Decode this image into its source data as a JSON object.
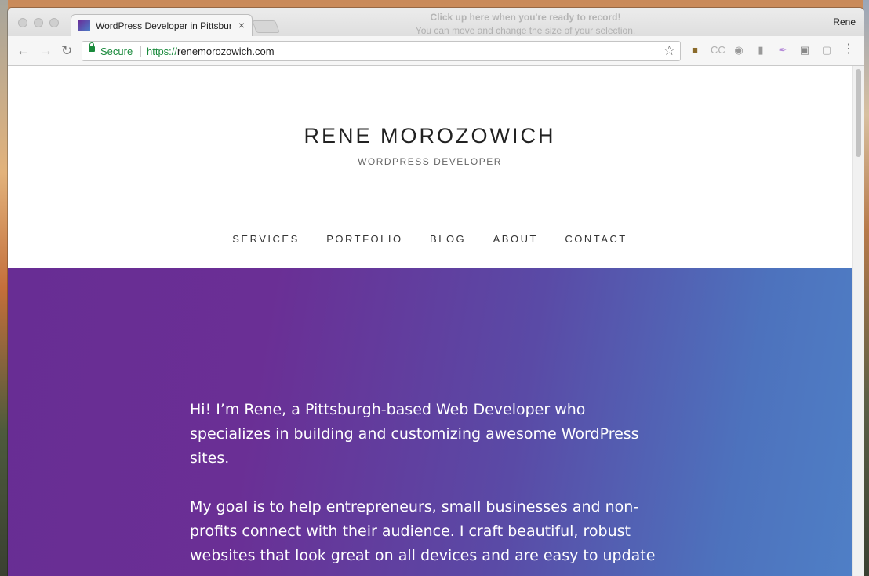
{
  "browser": {
    "tab": {
      "title": "WordPress Developer in Pittsburgh",
      "close": "×"
    },
    "record_hint": {
      "line1": "Click up here when you're ready to record!",
      "line2": "You can move and change the size of your selection."
    },
    "profile_name": "Rene",
    "toolbar": {
      "back": "←",
      "forward": "→",
      "reload": "↻",
      "secure_label": "Secure",
      "url_scheme": "https://",
      "url_host": "renemorozowich.com",
      "star": "☆",
      "menu": "⋮",
      "extensions": [
        "evernote-icon",
        "closed-captions-icon",
        "camera-icon",
        "bookmark-icon",
        "feather-icon",
        "cast-icon",
        "screen-icon"
      ]
    }
  },
  "site": {
    "title": "RENE MOROZOWICH",
    "tagline": "WORDPRESS DEVELOPER",
    "nav": [
      "SERVICES",
      "PORTFOLIO",
      "BLOG",
      "ABOUT",
      "CONTACT"
    ],
    "hero": {
      "paragraphs": [
        "Hi! I’m Rene, a Pittsburgh-based Web Developer who specializes in building and customizing awesome WordPress sites.",
        "My goal is to help entrepreneurs, small businesses and non-profits connect with their audience. I craft beautiful, robust websites that look great on all devices and are easy to update"
      ]
    }
  },
  "colors": {
    "secure_green": "#1a8a3c",
    "hero_gradient_start": "#682d94",
    "hero_gradient_end": "#4f7fc6"
  }
}
